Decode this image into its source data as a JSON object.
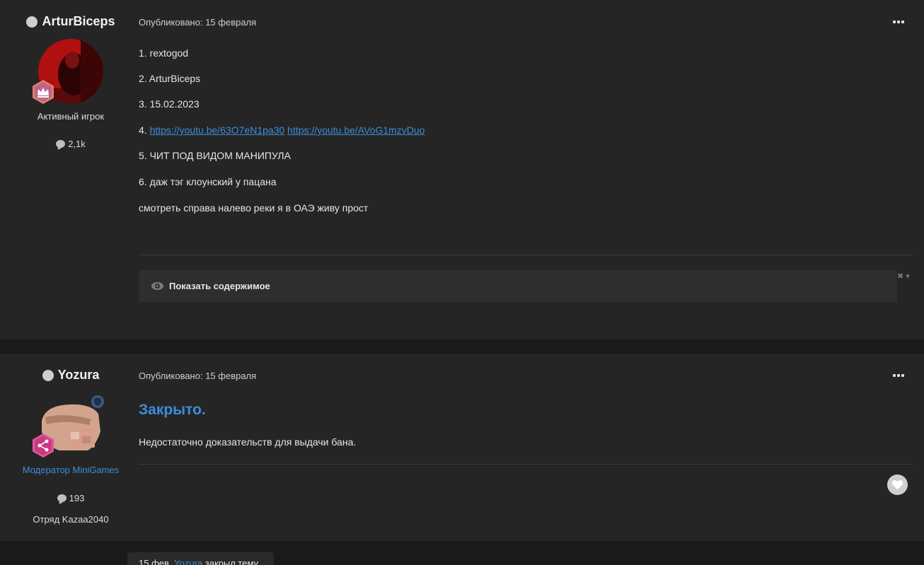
{
  "posts": [
    {
      "author": "ArturBiceps",
      "rank": "Активный игрок",
      "post_count": "2,1k",
      "published": "Опубликовано: 15 февраля",
      "lines": [
        "1. rextogod",
        "2. ArturBiceps",
        "3. 15.02.2023",
        "5. ЧИТ ПОД ВИДОМ МАНИПУЛА",
        "6. даж тэг клоунский у пацана",
        "смотреть справа налево реки я в ОАЭ живу прост"
      ],
      "link_line_prefix": "4.",
      "links": [
        "https://youtu.be/63O7eN1pa30",
        "https://youtu.be/AVoG1mzvDuo"
      ],
      "spoiler_label": "Показать содержимое",
      "spoiler_controls": "✖ ▾",
      "badge_icon": "crown-icon"
    },
    {
      "author": "Yozura",
      "rank": "Модератор MiniGames",
      "post_count": "193",
      "group": "Отряд Kazaa2040",
      "published": "Опубликовано: 15 февраля",
      "heading": "Закрыто.",
      "body": "Недостаточно доказательств для выдачи бана.",
      "badge_icon": "share-icon"
    }
  ],
  "event": {
    "date": "15 фев.",
    "user": "Yozura",
    "action": "закрыл тему"
  },
  "colors": {
    "accent": "#3c8ddb",
    "post_bg": "#252525",
    "page_bg": "#1a1a1a"
  }
}
